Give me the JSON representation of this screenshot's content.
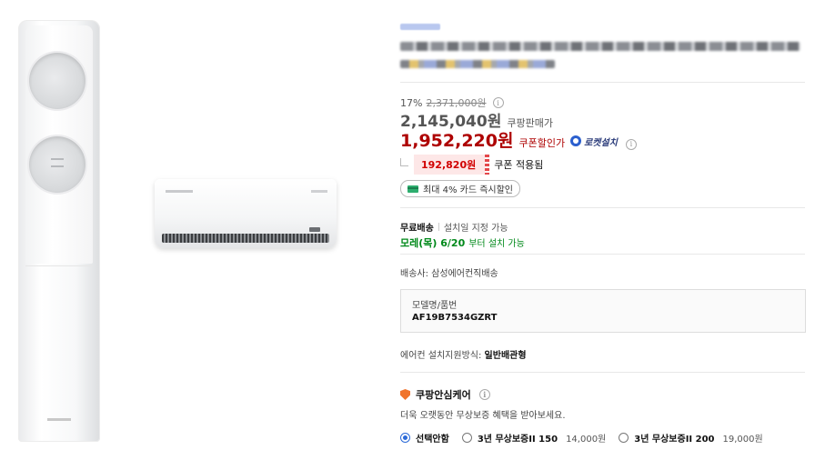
{
  "pricing": {
    "discount_rate": "17%",
    "original_price": "2,371,000원",
    "sale_price": "2,145,040원",
    "sale_label": "쿠팡판매가",
    "coupon_price": "1,952,220원",
    "coupon_label": "쿠폰할인가",
    "rocket_label": "로켓설치",
    "info_glyph": "i"
  },
  "coupon": {
    "amount": "192,820원",
    "applied_text": "쿠폰 적용됨"
  },
  "card_benefit": {
    "label": "최대 4% 카드 즉시할인"
  },
  "shipping": {
    "free_label": "무료배송",
    "date_option": "설치일 지정 가능",
    "arrival_date": "모레(목) 6/20",
    "arrival_suffix": "부터 설치 가능",
    "shipper": "배송사: 삼성에어컨직배송"
  },
  "model": {
    "label": "모델명/품번",
    "value": "AF19B7534GZRT"
  },
  "install_method": {
    "label": "에어컨 설치지원방식:",
    "value": "일반배관형"
  },
  "care": {
    "title": "쿠팡안심케어",
    "description": "더욱 오랫동안 무상보증 혜택을 받아보세요.",
    "options": [
      {
        "label": "선택안함",
        "price": "",
        "selected": true
      },
      {
        "label": "3년 무상보증II 150",
        "price": "14,000원",
        "selected": false
      },
      {
        "label": "3년 무상보증II 200",
        "price": "19,000원",
        "selected": false
      }
    ]
  },
  "colors": {
    "sale_price": "#555555",
    "coupon_price": "#ae0000",
    "delivery_green": "#00891a",
    "radio_blue": "#2b6ad8",
    "care_orange": "#f0742c"
  }
}
